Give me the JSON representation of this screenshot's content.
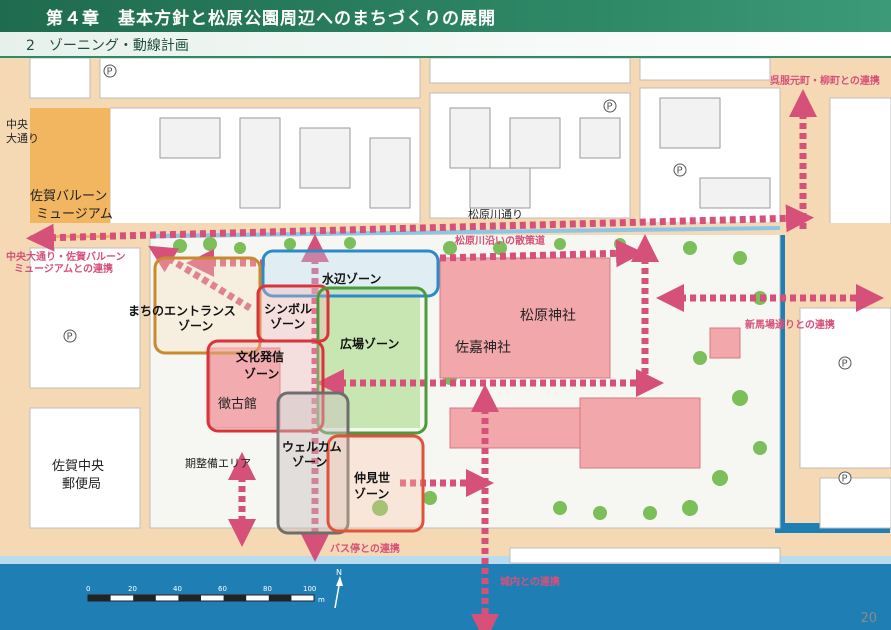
{
  "header": {
    "title": "第４章　基本方針と松原公園周辺へのまちづくりの展開"
  },
  "subheader": {
    "title": "2　ゾーニング・動線計画"
  },
  "zones": {
    "water": "水辺ゾーン",
    "entrance": [
      "まちのエントランス",
      "ゾーン"
    ],
    "symbol": [
      "シンボル",
      "ゾーン"
    ],
    "plaza": "広場ゾーン",
    "culture": [
      "文化発信",
      "ゾーン"
    ],
    "welcome": [
      "ウェルカム",
      "ゾーン"
    ],
    "nakamise": [
      "仲見世",
      "ゾーン"
    ]
  },
  "places": {
    "chuo_odori": [
      "中央",
      "大通り"
    ],
    "balloon_museum": [
      "佐賀バルーン",
      "ミュージアム"
    ],
    "matsubara_jinja": "松原神社",
    "saga_jinja": "佐嘉神社",
    "chokokan": "徴古館",
    "post_office": [
      "佐賀中央",
      "郵便局"
    ],
    "phase_area": "期整備エリア",
    "matsubaragawa_dori": "松原川通り"
  },
  "links": {
    "gofukumoto": "呉服元町・柳町との連携",
    "matsubaragawa_walk": "松原川沿いの散策道",
    "balloon_link": [
      "中央大通り・佐賀バルーン",
      "ミュージアムとの連携"
    ],
    "shinbaba": "新馬場通りとの連携",
    "bus_stop": "バス停との連携",
    "jonai": "城内との連携"
  },
  "scale": {
    "ticks": [
      "0",
      "20",
      "40",
      "60",
      "80",
      "100"
    ],
    "unit": "m"
  },
  "parking_symbol": "P",
  "north_symbol": "N",
  "page_number": "20",
  "colors": {
    "header_green": "#2f8a68",
    "road": "#f5d9b4",
    "water": "#1f7fb5",
    "arrow": "#d6517a",
    "zone_orange": "#c98a2e",
    "zone_blue": "#2d8ac6",
    "zone_red": "#d9343a",
    "zone_green": "#4c9a3a",
    "zone_gray": "#6e6e6e",
    "temple_pink": "#f2a7ab"
  }
}
